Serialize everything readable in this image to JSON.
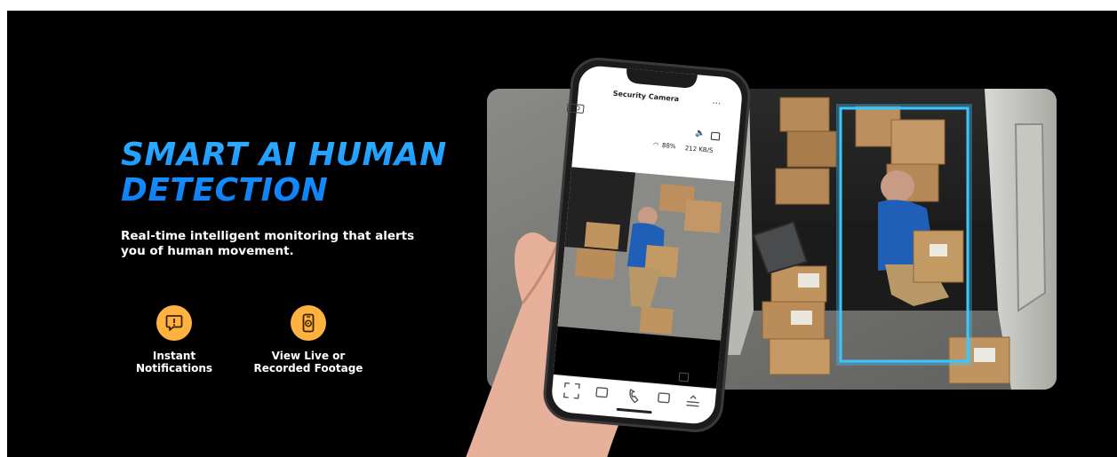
{
  "headline": {
    "line1": "SMART AI HUMAN",
    "line2": "DETECTION"
  },
  "subtitle": "Real-time intelligent monitoring that alerts you of human movement.",
  "features": [
    {
      "icon": "notification-icon",
      "line1": "Instant",
      "line2": "Notifications"
    },
    {
      "icon": "phone-camera-icon",
      "line1": "View Live or",
      "line2": "Recorded Footage"
    }
  ],
  "phone": {
    "title": "Security Camera",
    "hd_badge": "HD",
    "battery": "88%",
    "bitrate": "212 KB/S",
    "more": "…",
    "back": "‹"
  },
  "colors": {
    "accent_blue": "#1a9bff",
    "badge_orange": "#ffb23f",
    "detection_box": "#3cc7ff",
    "background": "#000000"
  }
}
